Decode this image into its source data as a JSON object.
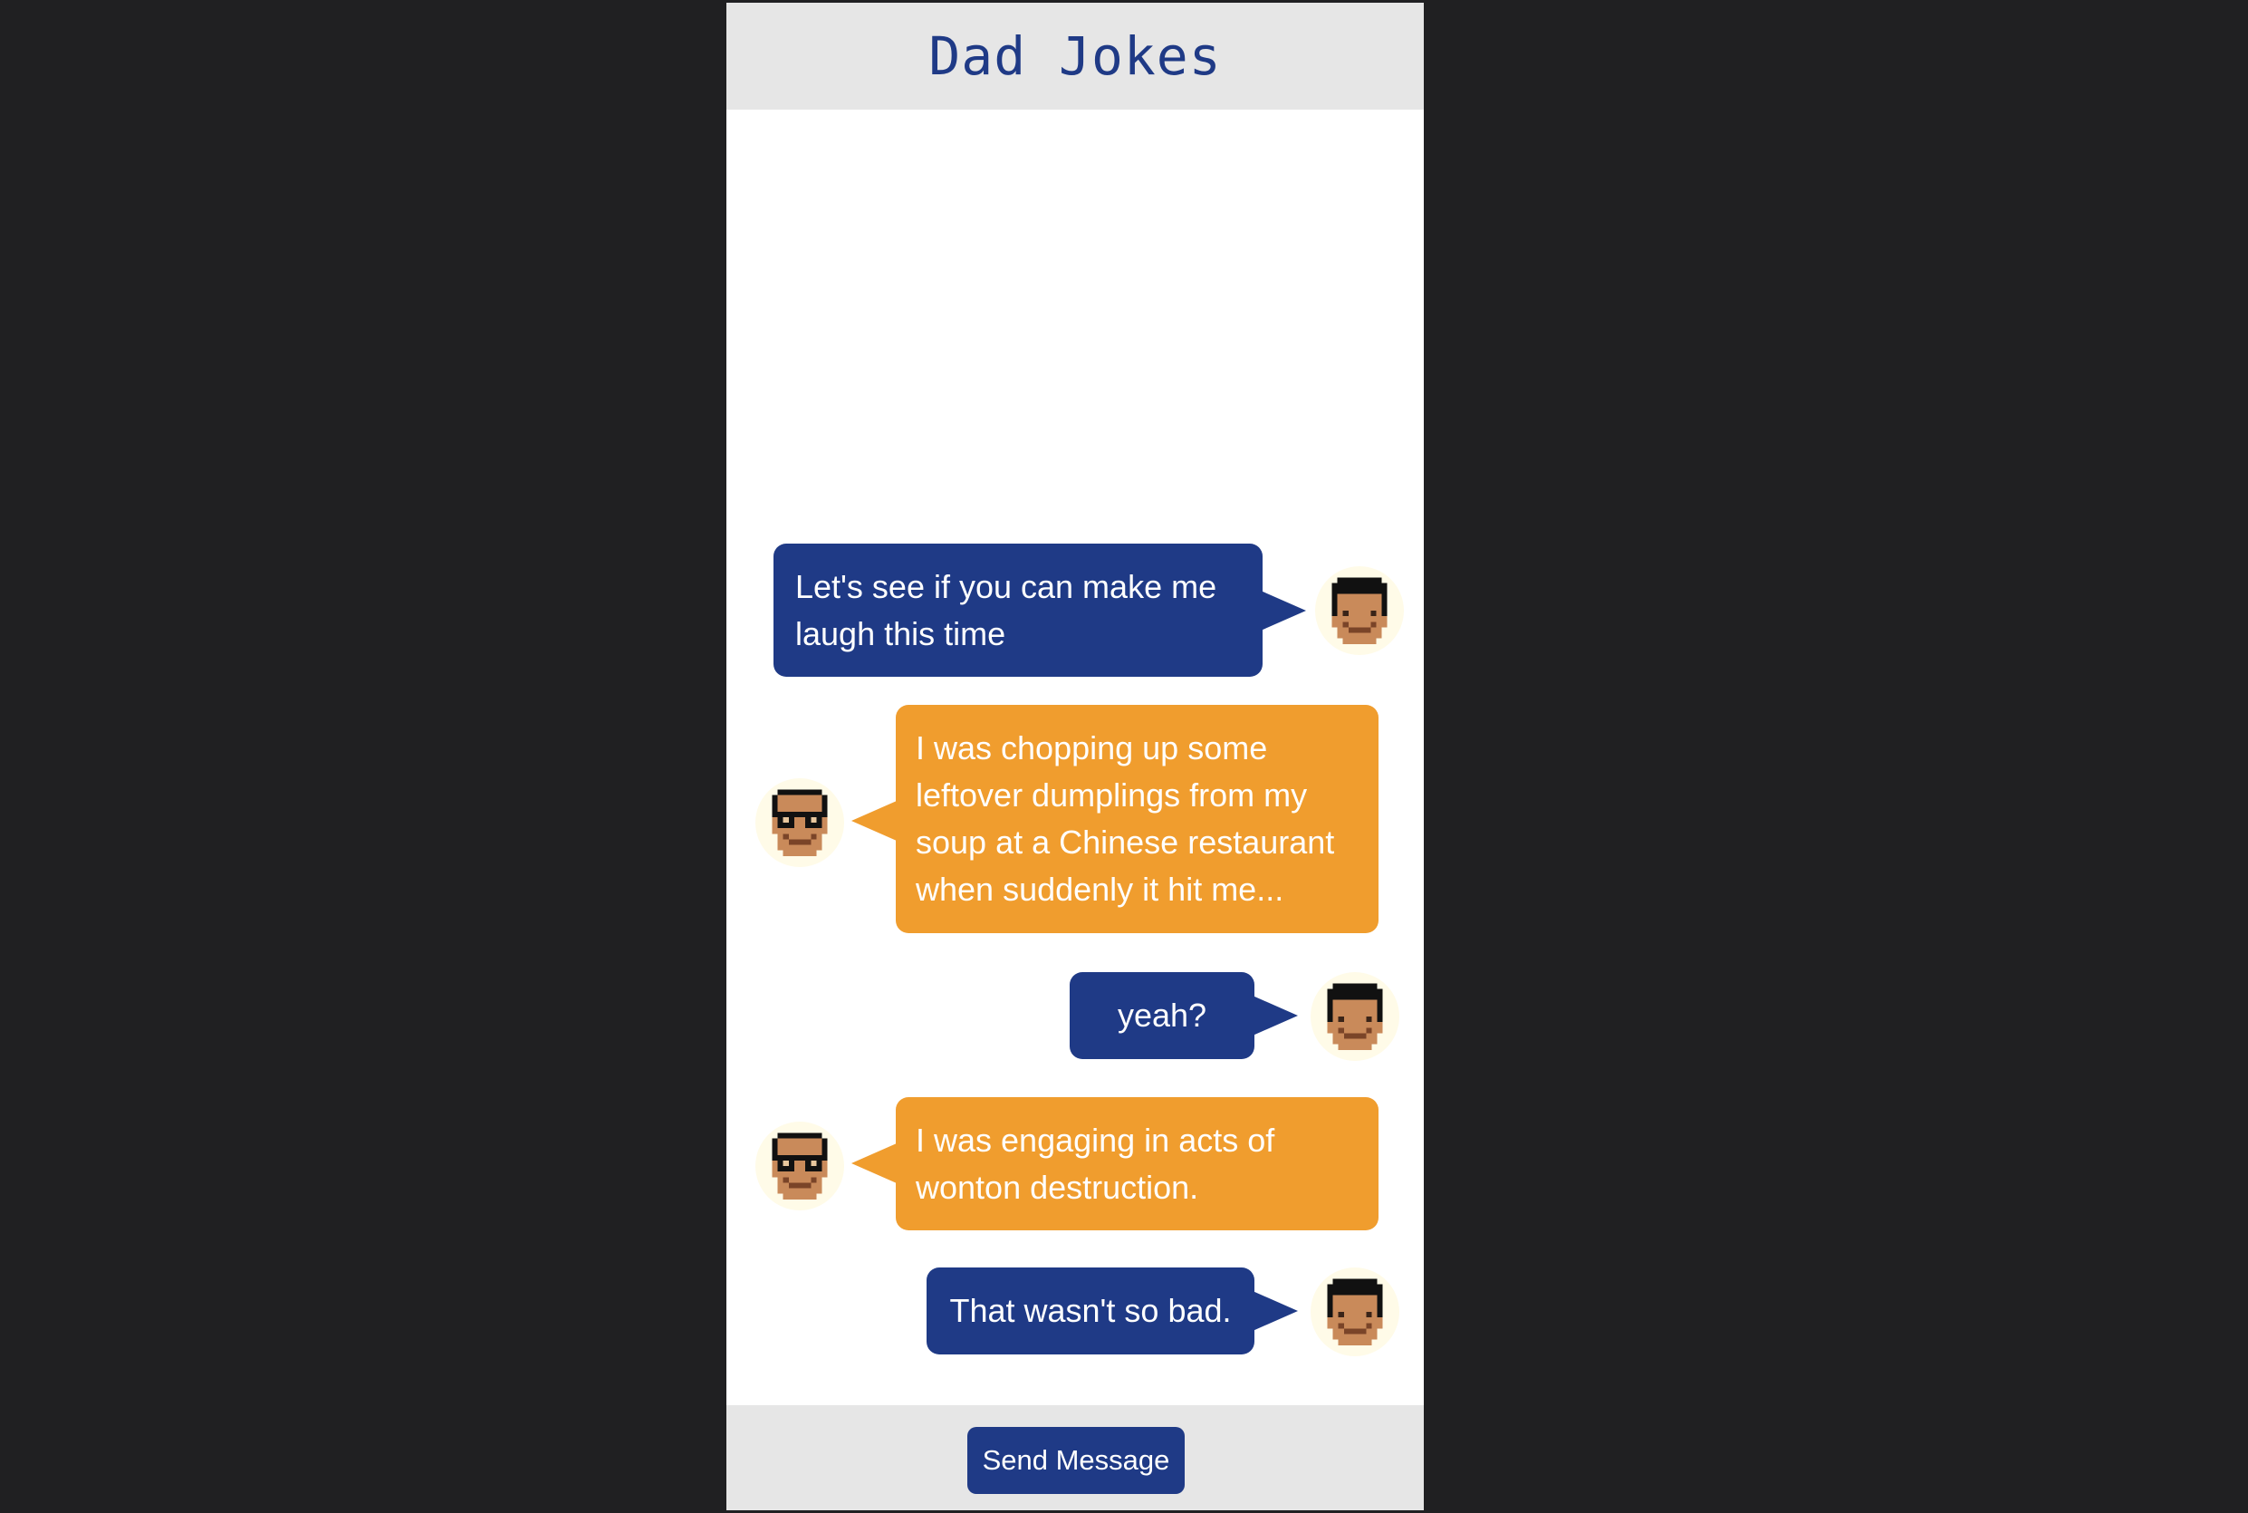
{
  "app": {
    "title": "Dad Jokes"
  },
  "messages": [
    {
      "speaker": "kid",
      "text": "Let's see if you can make me laugh this time"
    },
    {
      "speaker": "dad",
      "text": "I was chopping up some leftover dumplings from my soup at a Chinese restaurant when suddenly it hit me..."
    },
    {
      "speaker": "kid",
      "text": "yeah?"
    },
    {
      "speaker": "dad",
      "text": "I was engaging in acts of wonton destruction."
    },
    {
      "speaker": "kid",
      "text": "That wasn't so bad."
    }
  ],
  "footer": {
    "send_label": "Send Message"
  },
  "icons": {
    "kid_avatar": "kid-pixel-avatar-icon",
    "dad_avatar": "dad-pixel-avatar-with-glasses-icon"
  },
  "colors": {
    "kid_bubble": "#1f3a86",
    "dad_bubble": "#f09d2e",
    "header_text": "#1f3a86",
    "page_background": "#202022",
    "header_background": "#e6e6e6"
  }
}
